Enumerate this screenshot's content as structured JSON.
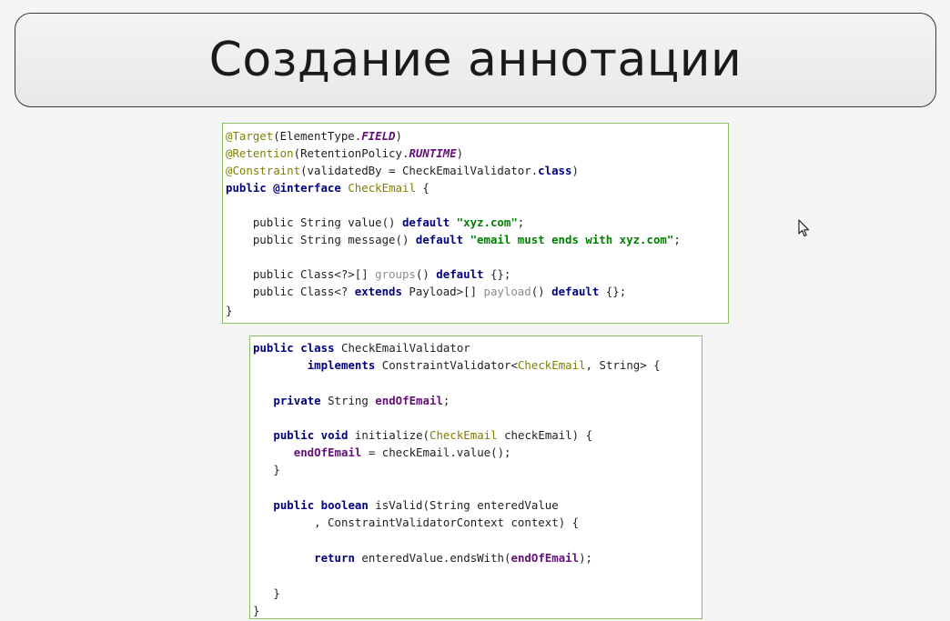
{
  "slide": {
    "title": "Создание аннотации"
  },
  "annotation_code": {
    "l1": {
      "a": "@Target",
      "b": "(ElementType.",
      "c": "FIELD",
      "d": ")"
    },
    "l2": {
      "a": "@Retention",
      "b": "(RetentionPolicy.",
      "c": "RUNTIME",
      "d": ")"
    },
    "l3": {
      "a": "@Constraint",
      "b": "(validatedBy = CheckEmailValidator.",
      "c": "class",
      "d": ")"
    },
    "l4": {
      "a": "public",
      "b": " ",
      "c": "@interface",
      "d": " ",
      "e": "CheckEmail",
      "f": " {"
    },
    "l5": {
      "a": "    public String value() ",
      "b": "default",
      "c": " ",
      "d": "\"xyz.com\"",
      "e": ";"
    },
    "l6": {
      "a": "    public String message() ",
      "b": "default",
      "c": " ",
      "d": "\"email must ends with xyz.com\"",
      "e": ";"
    },
    "l7": {
      "a": "    public Class<?>[] ",
      "b": "groups",
      "c": "() ",
      "d": "default",
      "e": " {};"
    },
    "l8": {
      "a": "    public Class<? ",
      "b": "extends",
      "c": " Payload>[] ",
      "d": "payload",
      "e": "() ",
      "f": "default",
      "g": " {};"
    },
    "l9": {
      "a": "}"
    }
  },
  "validator_code": {
    "l1": {
      "a": "public",
      "b": " ",
      "c": "class",
      "d": " CheckEmailValidator"
    },
    "l2": {
      "a": "        ",
      "b": "implements",
      "c": " ConstraintValidator<",
      "d": "CheckEmail",
      "e": ", String> {"
    },
    "l3": {
      "a": "   ",
      "b": "private",
      "c": " String ",
      "d": "endOfEmail",
      "e": ";"
    },
    "l4": {
      "a": "   ",
      "b": "public",
      "c": " ",
      "d": "void",
      "e": " initialize(",
      "f": "CheckEmail",
      "g": " checkEmail) {"
    },
    "l5": {
      "a": "      ",
      "b": "endOfEmail",
      "c": " = checkEmail.value();"
    },
    "l6": {
      "a": "   }"
    },
    "l7": {
      "a": "   ",
      "b": "public",
      "c": " ",
      "d": "boolean",
      "e": " isValid(String enteredValue"
    },
    "l8": {
      "a": "         , ConstraintValidatorContext context) {"
    },
    "l9": {
      "a": "         ",
      "b": "return",
      "c": " enteredValue.endsWith(",
      "d": "endOfEmail",
      "e": ");"
    },
    "l10": {
      "a": "   }"
    },
    "l11": {
      "a": "}"
    }
  },
  "icons": {
    "pointer": "mouse-cursor-icon"
  }
}
